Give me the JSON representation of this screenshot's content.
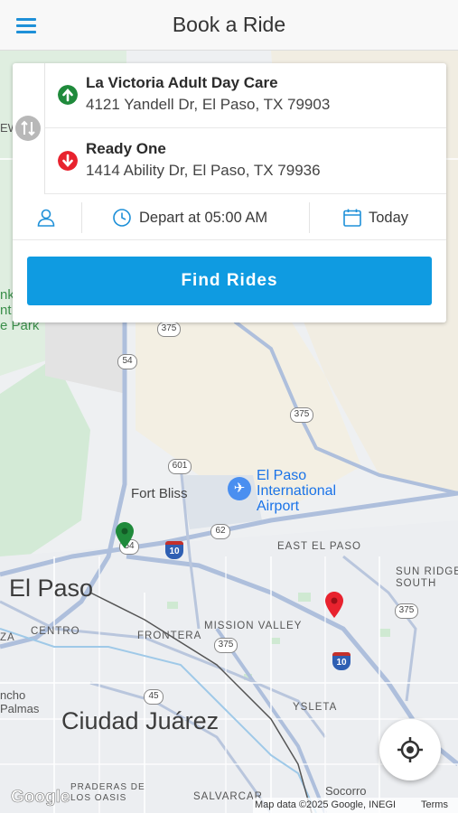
{
  "header": {
    "title": "Book a Ride",
    "menu_icon": "hamburger-menu-icon"
  },
  "trip": {
    "origin": {
      "name": "La Victoria Adult Day Care",
      "address": "4121 Yandell Dr, El Paso, TX 79903",
      "icon_color": "#1f8a3b"
    },
    "destination": {
      "name": "Ready One",
      "address": "1414 Ability Dr, El Paso, TX 79936",
      "icon_color": "#e8222e"
    },
    "options": {
      "depart_label": "Depart at 05:00 AM",
      "date_label": "Today"
    },
    "find_button_label": "Find Rides"
  },
  "colors": {
    "accent": "#0f9be1",
    "origin_green": "#1f8a3b",
    "destination_red": "#e8222e"
  },
  "map": {
    "labels": {
      "el_paso": "El Paso",
      "ciudad_juarez": "Ciudad Juárez",
      "fort_bliss": "Fort Bliss",
      "airport": [
        "El Paso",
        "International",
        "Airport"
      ],
      "east_el_paso": "EAST EL PASO",
      "sun_ridge": [
        "SUN RIDGE",
        "SOUTH"
      ],
      "centro": "CENTRO",
      "mission_valley": "MISSION VALLEY",
      "frontera": "FRONTERA",
      "ysleta": "YSLETA",
      "socorro": "Socorro",
      "salvarcar": "SALVARCAR",
      "praderas": [
        "PRADERAS DE",
        "LOS OASIS"
      ],
      "rancho": [
        "ncho",
        "Palmas"
      ],
      "za": "ZA",
      "park": [
        "nk",
        "nt",
        "e Park"
      ],
      "ew": "EW"
    },
    "shields": [
      "375",
      "54",
      "375",
      "601",
      "62",
      "375",
      "375",
      "45",
      "54"
    ],
    "interstates": [
      "10",
      "10"
    ],
    "attribution": "Map data ©2025 Google, INEGI",
    "terms": "Terms",
    "google_logo": "Google"
  }
}
